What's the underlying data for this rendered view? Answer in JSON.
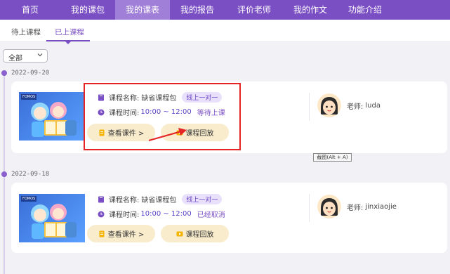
{
  "nav": {
    "items": [
      {
        "label": "首页"
      },
      {
        "label": "我的课包"
      },
      {
        "label": "我的课表"
      },
      {
        "label": "我的报告"
      },
      {
        "label": "评价老师"
      },
      {
        "label": "我的作文"
      },
      {
        "label": "功能介绍"
      }
    ],
    "active_index": 2,
    "color": "#7b4fc4"
  },
  "subtabs": {
    "items": [
      {
        "label": "待上课程"
      },
      {
        "label": "已上课程"
      }
    ],
    "active_index": 1
  },
  "filter": {
    "selected": "全部"
  },
  "records": [
    {
      "date": "2022-09-20",
      "thumbnail_logo": "FOMOS",
      "course_name_label": "课程名称:",
      "course_name": "缺省课程包",
      "course_type": "线上一对一",
      "course_time_label": "课程时间:",
      "course_time": "10:00 ~ 12:00",
      "status": "等待上课",
      "btn_courseware": "查看课件 >",
      "btn_replay": "课程回放",
      "teacher_label": "老师:",
      "teacher_name": "luda"
    },
    {
      "date": "2022-09-18",
      "thumbnail_logo": "FOMOS",
      "course_name_label": "课程名称:",
      "course_name": "缺省课程包",
      "course_type": "线上一对一",
      "course_time_label": "课程时间:",
      "course_time": "10:00 ~ 12:00",
      "status": "已经取消",
      "btn_courseware": "查看课件 >",
      "btn_replay": "课程回放",
      "teacher_label": "老师:",
      "teacher_name": "jinxiaojie"
    }
  ],
  "tooltip": "截图(Alt + A)",
  "colors": {
    "accent": "#7b4fc4",
    "button_bg": "#f8eccc",
    "annotation": "#e52525"
  }
}
